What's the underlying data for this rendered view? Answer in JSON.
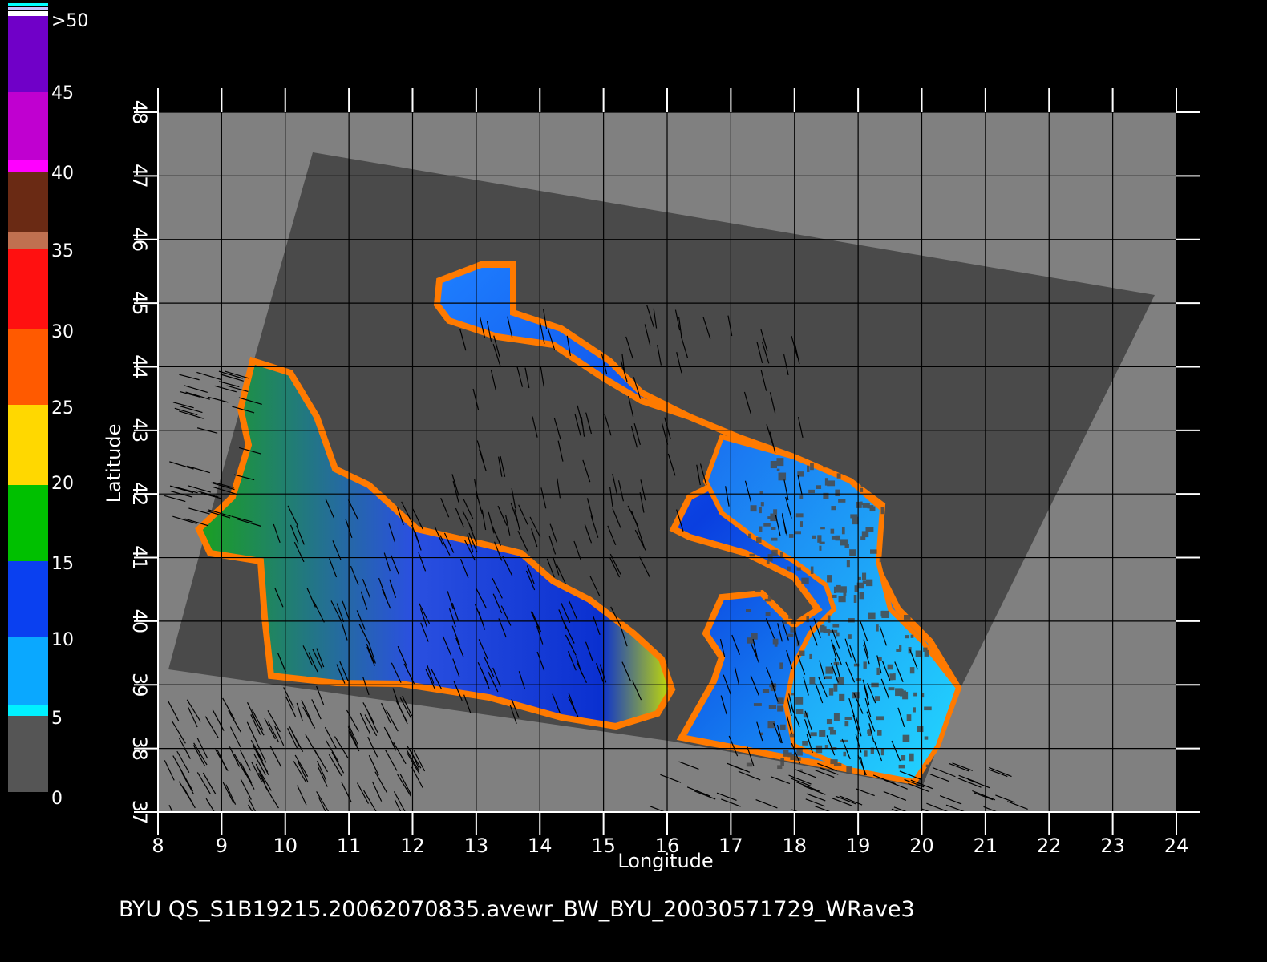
{
  "colorbar": {
    "labels": [
      ">50",
      "45",
      "40",
      "35",
      "30",
      "25",
      "20",
      "15",
      "10",
      "5",
      "0"
    ]
  },
  "axes": {
    "x_label": "Longitude",
    "y_label": "Latitude",
    "lon_ticks": [
      "8",
      "9",
      "10",
      "11",
      "12",
      "13",
      "14",
      "15",
      "16",
      "17",
      "18",
      "19",
      "20",
      "21",
      "22",
      "23",
      "24"
    ],
    "lat_ticks": [
      "37",
      "38",
      "39",
      "40",
      "41",
      "42",
      "43",
      "44",
      "45",
      "46",
      "47",
      "48"
    ]
  },
  "caption": "BYU  QS_S1B19215.20062070835.avewr_BW_BYU_20030571729_WRave3",
  "colors": {
    "background": "#000000",
    "land": "#808080",
    "swath": "#4a4a4a",
    "grid": "#000000"
  }
}
